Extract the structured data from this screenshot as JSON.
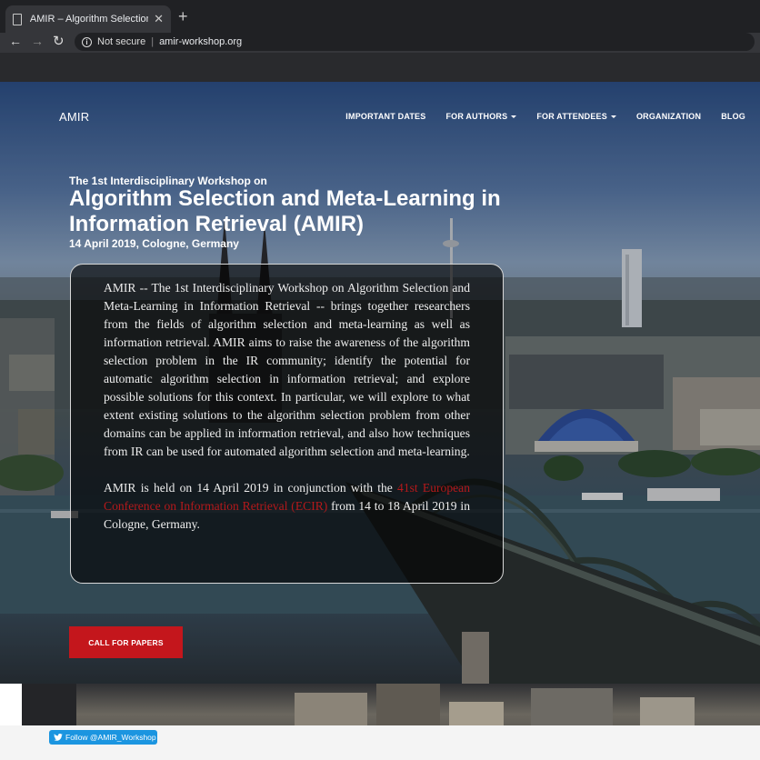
{
  "browser": {
    "tab_title": "AMIR – Algorithm Selection and M",
    "close_glyph": "✕",
    "new_tab_glyph": "+",
    "back_glyph": "←",
    "forward_glyph": "→",
    "reload_glyph": "↻",
    "security_label": "Not secure",
    "separator": "|",
    "url": "amir-workshop.org"
  },
  "site": {
    "brand": "AMIR",
    "nav": [
      {
        "label": "IMPORTANT DATES",
        "dropdown": false
      },
      {
        "label": "FOR AUTHORS",
        "dropdown": true
      },
      {
        "label": "FOR ATTENDEES",
        "dropdown": true
      },
      {
        "label": "ORGANIZATION",
        "dropdown": false
      },
      {
        "label": "BLOG",
        "dropdown": false
      }
    ]
  },
  "hero": {
    "subtitle": "The 1st Interdisciplinary Workshop on",
    "title": "Algorithm Selection and Meta-Learning in Information Retrieval (AMIR)",
    "date": "14 April 2019, Cologne, Germany",
    "paragraph1": "AMIR -- The 1st Interdisciplinary Workshop on Algorithm Selection and Meta-Learning in Information Retrieval -- brings together researchers from the fields of algorithm selection and meta-learning as well as information retrieval. AMIR aims to raise the awareness of the algorithm selection problem in the IR community; identify the potential for automatic algorithm selection in information retrieval; and explore possible solutions for this context. In particular, we will explore to what extent existing solutions to the algorithm selection problem from other domains can be applied in information retrieval, and also how techniques from IR can be used for automated algorithm selection and meta-learning.",
    "paragraph2_before": "AMIR is held on 14 April 2019 in conjunction with the ",
    "paragraph2_link": "41st European Conference on Information Retrieval (ECIR)",
    "paragraph2_after": " from 14 to 18 April 2019 in Cologne, Germany.",
    "cta_label": "CALL FOR PAPERS"
  },
  "twitter": {
    "follow_label": "Follow @AMIR_Workshop"
  },
  "colors": {
    "accent_red": "#c4161c",
    "link_red": "#b5191b",
    "twitter_blue": "#1b95e0"
  }
}
